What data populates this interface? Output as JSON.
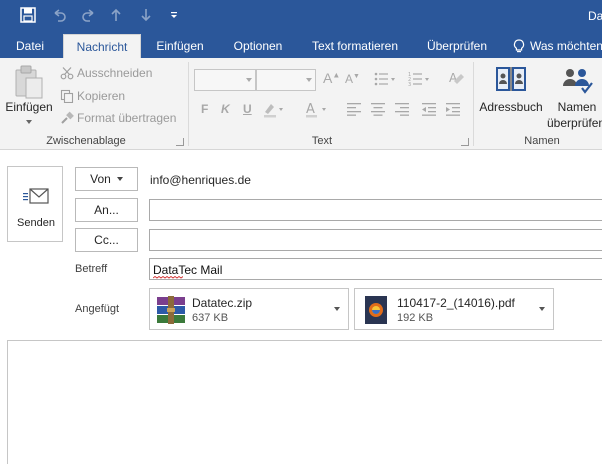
{
  "window": {
    "title": "Da"
  },
  "tabs": [
    {
      "label": "Datei"
    },
    {
      "label": "Nachricht"
    },
    {
      "label": "Einfügen"
    },
    {
      "label": "Optionen"
    },
    {
      "label": "Text formatieren"
    },
    {
      "label": "Überprüfen"
    },
    {
      "label": "Was möchten"
    }
  ],
  "ribbon": {
    "clipboard": {
      "paste_label": "Einfügen",
      "cut_label": "Ausschneiden",
      "copy_label": "Kopieren",
      "format_painter_label": "Format übertragen",
      "group_label": "Zwischenablage"
    },
    "text": {
      "group_label": "Text",
      "bold": "F",
      "italic": "K",
      "underline": "U"
    },
    "names": {
      "address_book_label": "Adressbuch",
      "check_names_line1": "Namen",
      "check_names_line2": "überprüfen",
      "group_label": "Namen"
    }
  },
  "compose": {
    "send_label": "Senden",
    "from_button": "Von",
    "from_value": "info@henriques.de",
    "to_button": "An...",
    "cc_button": "Cc...",
    "subject_label": "Betreff",
    "subject_value": "DataTec Mail",
    "attached_label": "Angefügt",
    "attachments": [
      {
        "name": "Datatec.zip",
        "size": "637 KB"
      },
      {
        "name": "110417-2_(14016).pdf",
        "size": "192 KB"
      }
    ]
  },
  "colors": {
    "brand_blue": "#2b579a",
    "ribbon_bg": "#f3f3f3"
  }
}
